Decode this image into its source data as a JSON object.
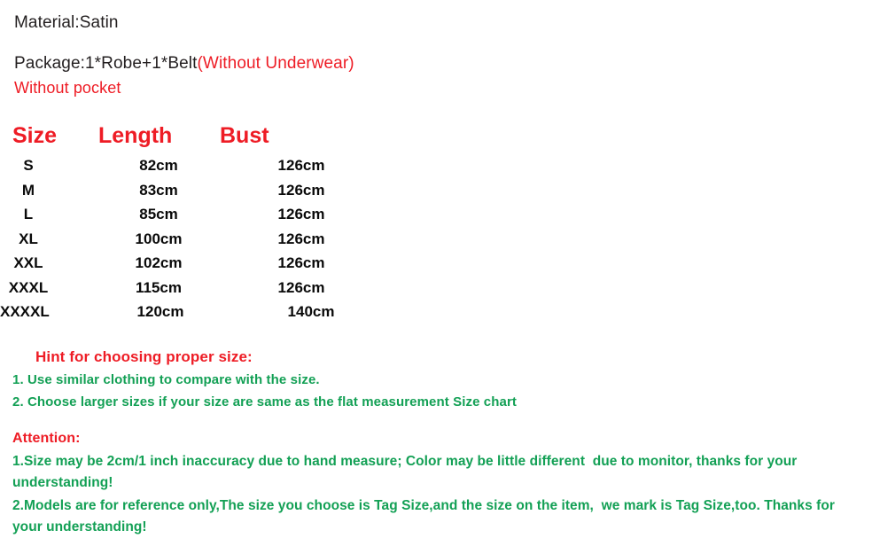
{
  "intro": {
    "material_line": "Material:Satin",
    "package_prefix": "Package:1*Robe+1*Belt",
    "package_note": "(Without Underwear)",
    "pocket_line": "Without pocket"
  },
  "size_chart": {
    "headers": {
      "size": "Size",
      "length": "Length",
      "bust": "Bust"
    },
    "rows": [
      {
        "size": "S",
        "length": "82cm",
        "bust": "126cm"
      },
      {
        "size": "M",
        "length": "83cm",
        "bust": "126cm"
      },
      {
        "size": "L",
        "length": "85cm",
        "bust": "126cm"
      },
      {
        "size": "XL",
        "length": "100cm",
        "bust": "126cm"
      },
      {
        "size": "XXL",
        "length": "102cm",
        "bust": "126cm"
      },
      {
        "size": "XXXL",
        "length": "115cm",
        "bust": "126cm"
      },
      {
        "size": "XXXXL",
        "length": "120cm",
        "bust": "140cm"
      }
    ]
  },
  "hint": {
    "title": "Hint for choosing proper size:",
    "items": [
      "1. Use similar clothing to compare with the size.",
      "2. Choose larger sizes if your size are same as the flat measurement Size chart"
    ]
  },
  "attention": {
    "title": "Attention:",
    "items": [
      "1.Size may be 2cm/1 inch inaccuracy due to hand measure; Color may be little different  due to monitor, thanks for your understanding!",
      "2.Models are for reference only,The size you choose is Tag Size,and the size on the item,  we mark is Tag Size,too. Thanks for your understanding!"
    ]
  },
  "colors": {
    "red": "#ee1c25",
    "green": "#13a055",
    "black": "#231f20",
    "background": "#ffffff"
  }
}
